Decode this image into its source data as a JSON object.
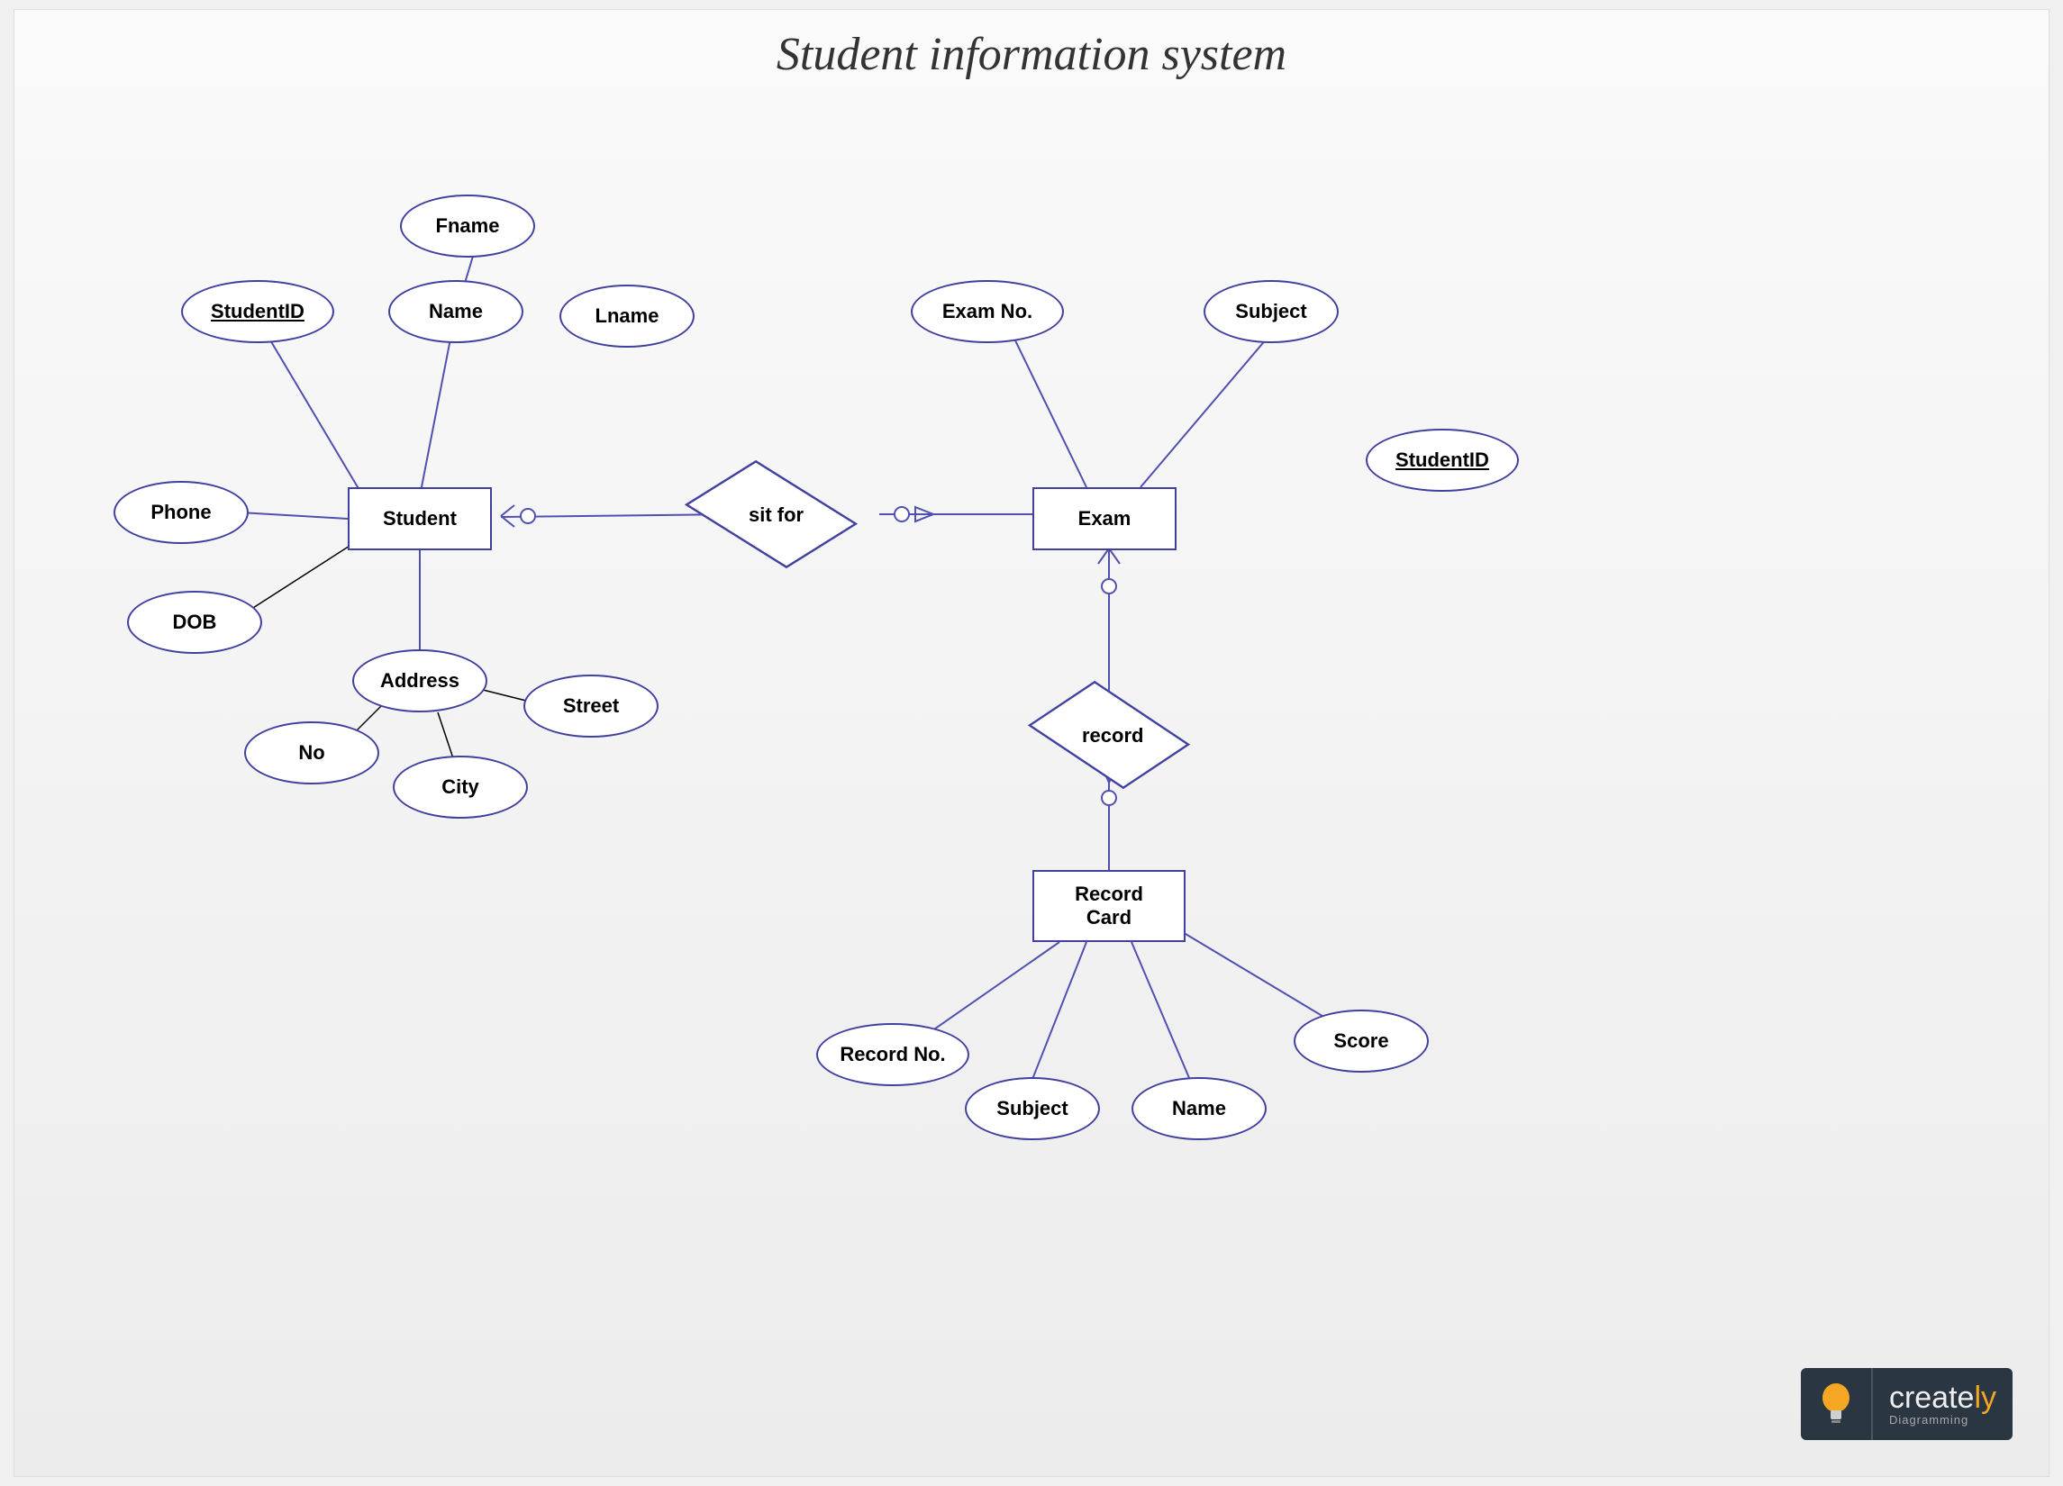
{
  "title": "Student information system",
  "entities": {
    "student": "Student",
    "exam": "Exam",
    "recordCard": "Record\nCard"
  },
  "relationships": {
    "sitFor": "sit for",
    "record": "record"
  },
  "attributes": {
    "studentId": "StudentID",
    "fname": "Fname",
    "name": "Name",
    "lname": "Lname",
    "phone": "Phone",
    "dob": "DOB",
    "address": "Address",
    "no": "No",
    "city": "City",
    "street": "Street",
    "examNo": "Exam No.",
    "subject": "Subject",
    "studentId2": "StudentID",
    "recordNo": "Record No.",
    "rcSubject": "Subject",
    "rcName": "Name",
    "score": "Score"
  },
  "logo": {
    "brand1": "create",
    "brand2": "ly",
    "sub": "Diagramming"
  }
}
